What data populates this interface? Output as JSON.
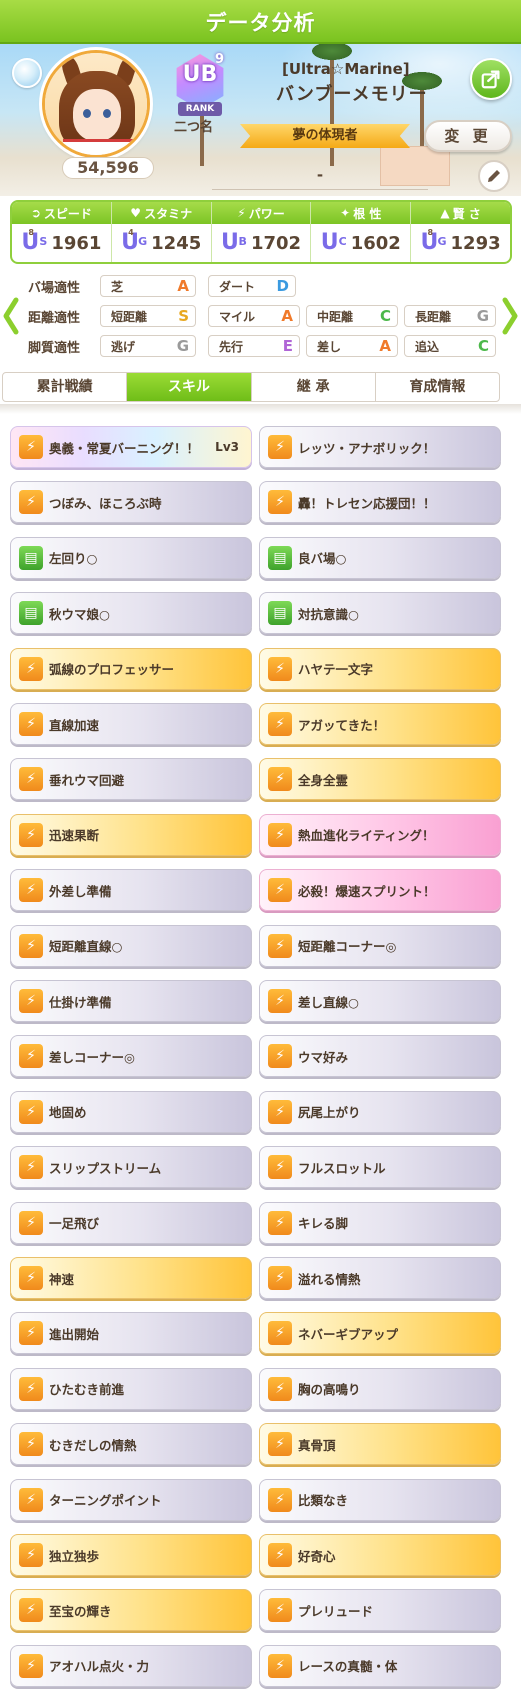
{
  "screen_title": "データ分析",
  "profile": {
    "score": "54,596",
    "rank_letters": "UB",
    "rank_sup": "9",
    "rank_label": "RANK",
    "nickname": "二つ名",
    "costume": "[Ultra☆Marine]",
    "character_name": "バンブーメモリー",
    "title_ribbon": "夢の体現者",
    "change_label": "変 更",
    "memo": "-"
  },
  "stats": [
    {
      "label": "スピード",
      "icon": "speed-icon",
      "grade": "U",
      "grade_sub": "S",
      "grade_sup": "8",
      "grade_color": "#7a6be8",
      "value": "1961"
    },
    {
      "label": "スタミナ",
      "icon": "heart-icon",
      "grade": "U",
      "grade_sub": "G",
      "grade_sup": "4",
      "grade_color": "#7a6be8",
      "value": "1245"
    },
    {
      "label": "パワー",
      "icon": "power-icon",
      "grade": "U",
      "grade_sub": "B",
      "grade_sup": "",
      "grade_color": "#7a6be8",
      "value": "1702"
    },
    {
      "label": "根 性",
      "icon": "flame-icon",
      "grade": "U",
      "grade_sub": "C",
      "grade_sup": "",
      "grade_color": "#7a6be8",
      "value": "1602"
    },
    {
      "label": "賢 さ",
      "icon": "grad-cap-icon",
      "grade": "U",
      "grade_sub": "G",
      "grade_sup": "8",
      "grade_color": "#7a6be8",
      "value": "1293"
    }
  ],
  "aptitude": {
    "rows": [
      {
        "head": "バ場適性",
        "cells": [
          {
            "name": "芝",
            "grade": "A"
          },
          {
            "name": "ダート",
            "grade": "D"
          }
        ]
      },
      {
        "head": "距離適性",
        "cells": [
          {
            "name": "短距離",
            "grade": "S"
          },
          {
            "name": "マイル",
            "grade": "A"
          },
          {
            "name": "中距離",
            "grade": "C"
          },
          {
            "name": "長距離",
            "grade": "G"
          }
        ]
      },
      {
        "head": "脚質適性",
        "cells": [
          {
            "name": "逃げ",
            "grade": "G"
          },
          {
            "name": "先行",
            "grade": "E"
          },
          {
            "name": "差し",
            "grade": "A"
          },
          {
            "name": "追込",
            "grade": "C"
          }
        ]
      }
    ],
    "grade_colors": {
      "S": "#e8a820",
      "A": "#f07a2a",
      "B": "#e65aa0",
      "C": "#4cb84a",
      "D": "#3b9ae0",
      "E": "#b065d6",
      "G": "#9a9a9a"
    }
  },
  "tabs": [
    {
      "label": "累計戦績",
      "active": false
    },
    {
      "label": "スキル",
      "active": true
    },
    {
      "label": "継 承",
      "active": false
    },
    {
      "label": "育成情報",
      "active": false
    }
  ],
  "skills": [
    {
      "name": "奥義・常夏バーニング！！",
      "lv": "Lv3",
      "style": "rainbow",
      "icon": "unique-skill-icon"
    },
    {
      "name": "レッツ・アナボリック！",
      "lv": "",
      "style": "white",
      "icon": "speed-skill-icon"
    },
    {
      "name": "つぼみ、ほころぶ時",
      "lv": "",
      "style": "white",
      "icon": "speed-skill-icon"
    },
    {
      "name": "轟！トレセン応援団！！",
      "lv": "",
      "style": "white",
      "icon": "speed-skill-icon"
    },
    {
      "name": "左回り○",
      "lv": "",
      "style": "white",
      "icon": "green-skill-icon"
    },
    {
      "name": "良バ場○",
      "lv": "",
      "style": "white",
      "icon": "green-skill-icon"
    },
    {
      "name": "秋ウマ娘○",
      "lv": "",
      "style": "white",
      "icon": "green-skill-icon"
    },
    {
      "name": "対抗意識○",
      "lv": "",
      "style": "white",
      "icon": "green-skill-icon"
    },
    {
      "name": "弧線のプロフェッサー",
      "lv": "",
      "style": "gold",
      "icon": "speed-skill-icon"
    },
    {
      "name": "ハヤテ一文字",
      "lv": "",
      "style": "gold",
      "icon": "speed-skill-icon"
    },
    {
      "name": "直線加速",
      "lv": "",
      "style": "white",
      "icon": "speed-skill-icon"
    },
    {
      "name": "アガッてきた！",
      "lv": "",
      "style": "gold",
      "icon": "speed-skill-icon"
    },
    {
      "name": "垂れウマ回避",
      "lv": "",
      "style": "white",
      "icon": "speed-skill-icon"
    },
    {
      "name": "全身全霊",
      "lv": "",
      "style": "gold",
      "icon": "speed-skill-icon"
    },
    {
      "name": "迅速果断",
      "lv": "",
      "style": "gold",
      "icon": "speed-skill-icon"
    },
    {
      "name": "熱血進化ライティング！",
      "lv": "",
      "style": "pink",
      "icon": "speed-skill-icon"
    },
    {
      "name": "外差し準備",
      "lv": "",
      "style": "white",
      "icon": "speed-skill-icon"
    },
    {
      "name": "必殺！爆速スプリント！",
      "lv": "",
      "style": "pink",
      "icon": "speed-skill-icon"
    },
    {
      "name": "短距離直線○",
      "lv": "",
      "style": "white",
      "icon": "speed-skill-icon"
    },
    {
      "name": "短距離コーナー◎",
      "lv": "",
      "style": "white",
      "icon": "speed-skill-icon"
    },
    {
      "name": "仕掛け準備",
      "lv": "",
      "style": "white",
      "icon": "speed-skill-icon"
    },
    {
      "name": "差し直線○",
      "lv": "",
      "style": "white",
      "icon": "speed-skill-icon"
    },
    {
      "name": "差しコーナー◎",
      "lv": "",
      "style": "white",
      "icon": "speed-skill-icon"
    },
    {
      "name": "ウマ好み",
      "lv": "",
      "style": "white",
      "icon": "speed-skill-icon"
    },
    {
      "name": "地固め",
      "lv": "",
      "style": "white",
      "icon": "speed-skill-icon"
    },
    {
      "name": "尻尾上がり",
      "lv": "",
      "style": "white",
      "icon": "speed-skill-icon"
    },
    {
      "name": "スリップストリーム",
      "lv": "",
      "style": "white",
      "icon": "speed-skill-icon"
    },
    {
      "name": "フルスロットル",
      "lv": "",
      "style": "white",
      "icon": "speed-skill-icon"
    },
    {
      "name": "一足飛び",
      "lv": "",
      "style": "white",
      "icon": "speed-skill-icon"
    },
    {
      "name": "キレる脚",
      "lv": "",
      "style": "white",
      "icon": "speed-skill-icon"
    },
    {
      "name": "神速",
      "lv": "",
      "style": "gold",
      "icon": "speed-skill-icon"
    },
    {
      "name": "溢れる情熱",
      "lv": "",
      "style": "white",
      "icon": "speed-skill-icon"
    },
    {
      "name": "進出開始",
      "lv": "",
      "style": "white",
      "icon": "speed-skill-icon"
    },
    {
      "name": "ネバーギブアップ",
      "lv": "",
      "style": "gold",
      "icon": "speed-skill-icon"
    },
    {
      "name": "ひたむき前進",
      "lv": "",
      "style": "white",
      "icon": "speed-skill-icon"
    },
    {
      "name": "胸の高鳴り",
      "lv": "",
      "style": "white",
      "icon": "speed-skill-icon"
    },
    {
      "name": "むきだしの情熱",
      "lv": "",
      "style": "white",
      "icon": "speed-skill-icon"
    },
    {
      "name": "真骨頂",
      "lv": "",
      "style": "gold",
      "icon": "speed-skill-icon"
    },
    {
      "name": "ターニングポイント",
      "lv": "",
      "style": "white",
      "icon": "speed-skill-icon"
    },
    {
      "name": "比類なき",
      "lv": "",
      "style": "white",
      "icon": "speed-skill-icon"
    },
    {
      "name": "独立独歩",
      "lv": "",
      "style": "gold",
      "icon": "speed-skill-icon"
    },
    {
      "name": "好奇心",
      "lv": "",
      "style": "gold",
      "icon": "speed-skill-icon"
    },
    {
      "name": "至宝の輝き",
      "lv": "",
      "style": "gold",
      "icon": "speed-skill-icon"
    },
    {
      "name": "プレリュード",
      "lv": "",
      "style": "white",
      "icon": "speed-skill-icon"
    },
    {
      "name": "アオハル点火・力",
      "lv": "",
      "style": "white",
      "icon": "speed-skill-icon"
    },
    {
      "name": "レースの真髄・体",
      "lv": "",
      "style": "white",
      "icon": "speed-skill-icon"
    }
  ]
}
